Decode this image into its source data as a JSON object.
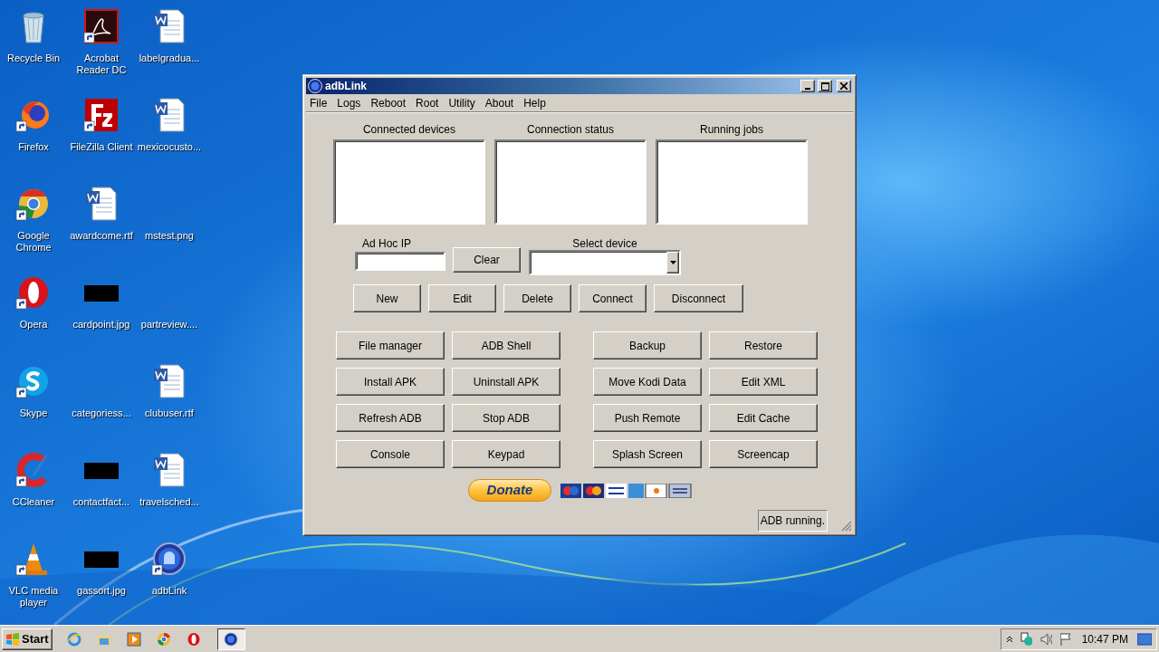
{
  "desktop_icons": [
    {
      "label": "Recycle Bin",
      "kind": "recycle",
      "shortcut": false
    },
    {
      "label": "Firefox",
      "kind": "firefox",
      "shortcut": true
    },
    {
      "label": "Google Chrome",
      "kind": "chrome",
      "shortcut": true
    },
    {
      "label": "Opera",
      "kind": "opera",
      "shortcut": true
    },
    {
      "label": "Skype",
      "kind": "skype",
      "shortcut": true
    },
    {
      "label": "CCleaner",
      "kind": "ccleaner",
      "shortcut": true
    },
    {
      "label": "VLC media player",
      "kind": "vlc",
      "shortcut": true
    },
    {
      "label": "Acrobat Reader DC",
      "kind": "acrobat",
      "shortcut": true
    },
    {
      "label": "FileZilla Client",
      "kind": "filezilla",
      "shortcut": true
    },
    {
      "label": "awardcome.rtf",
      "kind": "word",
      "shortcut": false
    },
    {
      "label": "cardpoint.jpg",
      "kind": "black",
      "shortcut": false
    },
    {
      "label": "categoriess...",
      "kind": "blank",
      "shortcut": false
    },
    {
      "label": "contactfact...",
      "kind": "black",
      "shortcut": false
    },
    {
      "label": "gassort.jpg",
      "kind": "black",
      "shortcut": false
    },
    {
      "label": "labelgradua...",
      "kind": "word",
      "shortcut": false
    },
    {
      "label": "mexicocusto...",
      "kind": "word",
      "shortcut": false
    },
    {
      "label": "mstest.png",
      "kind": "blank",
      "shortcut": false
    },
    {
      "label": "partreview....",
      "kind": "blank",
      "shortcut": false
    },
    {
      "label": "clubuser.rtf",
      "kind": "word",
      "shortcut": false
    },
    {
      "label": "travelsched...",
      "kind": "word",
      "shortcut": false
    },
    {
      "label": "adbLink",
      "kind": "adblink",
      "shortcut": true
    }
  ],
  "window": {
    "title": "adbLink",
    "menu": [
      "File",
      "Logs",
      "Reboot",
      "Root",
      "Utility",
      "About",
      "Help"
    ],
    "list_panels": [
      {
        "label": "Connected devices"
      },
      {
        "label": "Connection status"
      },
      {
        "label": "Running jobs"
      }
    ],
    "adhoc_ip": {
      "label": "Ad Hoc IP"
    },
    "clear_button": "Clear",
    "select_device": {
      "label": "Select device"
    },
    "device_buttons": [
      "New",
      "Edit",
      "Delete",
      "Connect",
      "Disconnect"
    ],
    "tool_buttons": [
      "File manager",
      "ADB Shell",
      "Backup",
      "Restore",
      "Install APK",
      "Uninstall APK",
      "Move Kodi Data",
      "Edit XML",
      "Refresh ADB",
      "Stop ADB",
      "Push Remote",
      "Edit Cache",
      "Console",
      "Keypad",
      "Splash Screen",
      "Screencap"
    ],
    "donate_button": "Donate",
    "status": "ADB running."
  },
  "taskbar": {
    "start": "Start",
    "quick_launch": [
      {
        "kind": "ie"
      },
      {
        "kind": "explorer"
      },
      {
        "kind": "media"
      },
      {
        "kind": "chrome"
      },
      {
        "kind": "opera"
      }
    ],
    "tasks": [
      {
        "kind": "adblink",
        "selected": true
      }
    ],
    "clock": "10:47 PM"
  }
}
